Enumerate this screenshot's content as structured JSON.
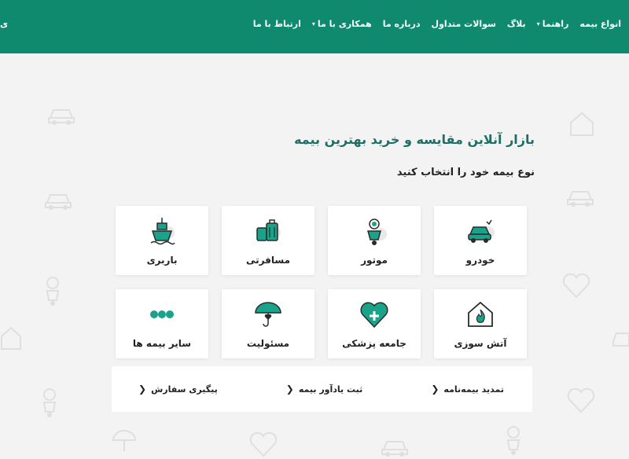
{
  "nav": {
    "items": [
      {
        "label": "انواع بیمه",
        "dropdown": false
      },
      {
        "label": "راهنما",
        "dropdown": true
      },
      {
        "label": "بلاگ",
        "dropdown": false
      },
      {
        "label": "سوالات متداول",
        "dropdown": false
      },
      {
        "label": "درباره ما",
        "dropdown": false
      },
      {
        "label": "همکاری با ما",
        "dropdown": true
      },
      {
        "label": "ارتباط با ما",
        "dropdown": false
      }
    ],
    "edge_text": "ی"
  },
  "hero": {
    "title": "بازار آنلاین مقایسه و خرید بهترین بیمه",
    "subtitle": "نوع بیمه خود را انتخاب کنید"
  },
  "cards": [
    {
      "label": "خودرو",
      "icon": "car-icon"
    },
    {
      "label": "موتور",
      "icon": "motorcycle-icon"
    },
    {
      "label": "مسافرتی",
      "icon": "luggage-icon"
    },
    {
      "label": "باربری",
      "icon": "ship-icon"
    },
    {
      "label": "آتش سوزی",
      "icon": "fire-house-icon"
    },
    {
      "label": "جامعه پزشکی",
      "icon": "medical-heart-icon"
    },
    {
      "label": "مسئولیت",
      "icon": "umbrella-heart-icon"
    },
    {
      "label": "سایر بیمه ها",
      "icon": "more-dots-icon"
    }
  ],
  "links": [
    {
      "label": "تمدید بیمه‌نامه"
    },
    {
      "label": "ثبت یادآور بیمه"
    },
    {
      "label": "پیگیری سفارش"
    }
  ],
  "colors": {
    "primary": "#0f8a6f",
    "icon_teal": "#18a38a",
    "icon_dark": "#2b2b2b",
    "background": "#f3f3f3"
  }
}
